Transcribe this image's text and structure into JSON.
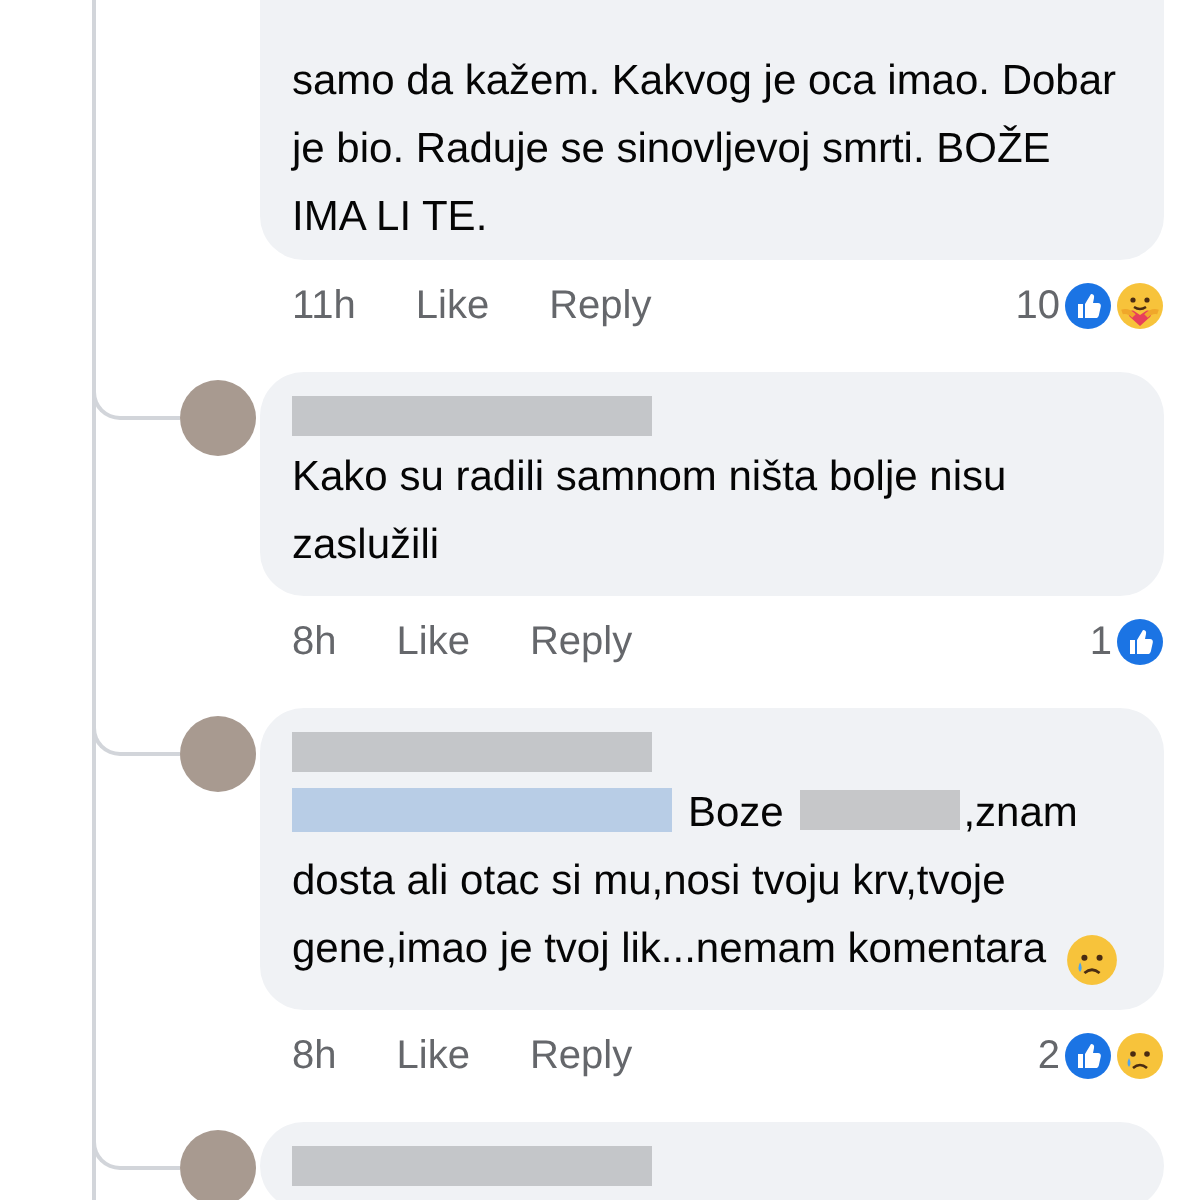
{
  "comments": [
    {
      "author": {
        "hidden": false,
        "avatar": false
      },
      "segments": [
        {
          "kind": "text",
          "text": "samo da kažem. Kakvog je oca imao. Dobar je bio. Raduje se sinovljevoj smrti. BOŽE IMA LI TE."
        }
      ],
      "time": "11h",
      "like": "Like",
      "reply": "Reply",
      "reaction_count": "10",
      "reactions": [
        {
          "kind": "like"
        },
        {
          "kind": "care"
        }
      ]
    },
    {
      "author": {
        "hidden": true,
        "avatar": true
      },
      "segments": [
        {
          "kind": "text",
          "text": "Kako su radili samnom ništa bolje nisu zaslužili"
        }
      ],
      "time": "8h",
      "like": "Like",
      "reply": "Reply",
      "reaction_count": "1",
      "reactions": [
        {
          "kind": "like"
        }
      ]
    },
    {
      "author": {
        "hidden": true,
        "avatar": true
      },
      "segments": [
        {
          "kind": "hidden_mention"
        },
        {
          "kind": "text",
          "text": "Boze"
        },
        {
          "kind": "hidden"
        },
        {
          "kind": "text",
          "text": ",znam"
        },
        {
          "kind": "para",
          "text": "dosta ali otac si mu,nosi tvoju krv,tvoje gene,imao je tvoj lik...nemam komentara"
        },
        {
          "kind": "sad_emoji"
        }
      ],
      "time": "8h",
      "like": "Like",
      "reply": "Reply",
      "reaction_count": "2",
      "reactions": [
        {
          "kind": "like"
        },
        {
          "kind": "sad"
        }
      ]
    },
    {
      "author": {
        "hidden": true,
        "avatar": true
      }
    }
  ]
}
